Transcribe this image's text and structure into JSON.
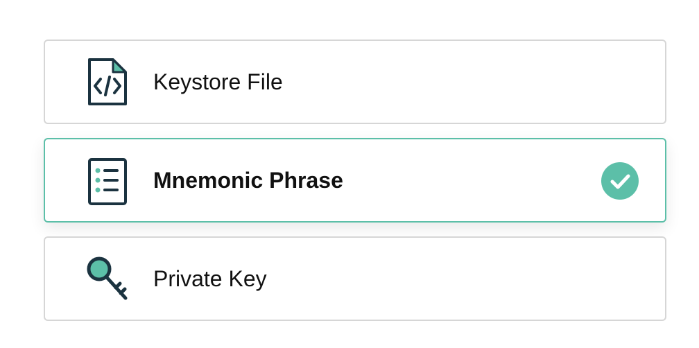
{
  "options": [
    {
      "label": "Keystore File",
      "icon": "code-file-icon",
      "selected": false
    },
    {
      "label": "Mnemonic Phrase",
      "icon": "list-document-icon",
      "selected": true
    },
    {
      "label": "Private Key",
      "icon": "key-icon",
      "selected": false
    }
  ],
  "colors": {
    "accent": "#5cbfa8",
    "icon_dark": "#1b3340",
    "border": "#d6d6d6",
    "text": "#111111"
  }
}
